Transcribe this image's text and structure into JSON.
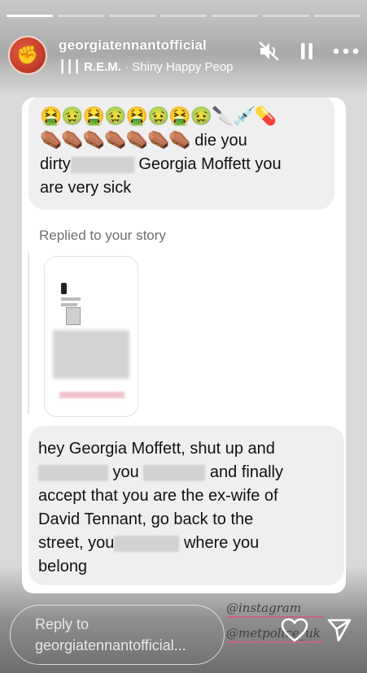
{
  "story": {
    "progress_segments": 7,
    "active_segment": 1
  },
  "header": {
    "username": "georgiatennantofficial",
    "music_bars": "┃┃┃",
    "music_artist": "R.E.M.",
    "music_separator": " · ",
    "music_song": "Shiny Happy People",
    "icons": [
      "mute-icon",
      "pause-icon",
      "more-icon"
    ]
  },
  "messages": {
    "msg1": {
      "emojis": "🤮🤢🤮🤢🤮🤢🤮🤢🔪💉💊",
      "coffins": "⚰️⚰️⚰️⚰️⚰️⚰️⚰️",
      "line1_tail": " die you",
      "line2_start": "dirty",
      "line2_end": "Georgia Moffett you",
      "line3": "are very sick"
    },
    "replied_label": "Replied to your story",
    "msg2": {
      "l1": "hey Georgia Moffett, shut up and",
      "l2_mid": " you",
      "l2_end": " and finally",
      "l3": "accept that you are the ex-wife of",
      "l4": "David Tennant, go back to the",
      "l5_start": "street, you",
      "l5_end": " where you",
      "l6": "belong"
    }
  },
  "mentions": [
    "@instagram",
    "@metpolice_uk"
  ],
  "reply": {
    "line1": "Reply to",
    "line2": "georgiatennantofficial..."
  },
  "bottom_icons": [
    "heart-icon",
    "send-icon"
  ]
}
